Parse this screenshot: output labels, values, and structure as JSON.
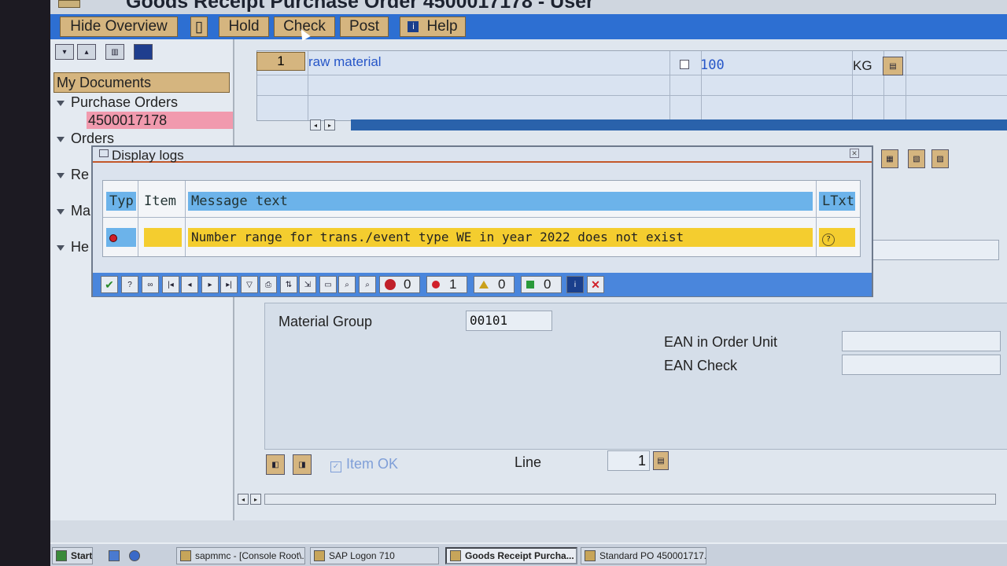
{
  "window": {
    "title": "Goods Receipt Purchase Order 4500017178 - User"
  },
  "toolbar": {
    "hide_overview": "Hide Overview",
    "hold": "Hold",
    "check": "Check",
    "post": "Post",
    "help": "Help"
  },
  "sidebar": {
    "my_documents": "My Documents",
    "purchase_orders": "Purchase Orders",
    "selected_po": "4500017178",
    "orders": "Orders",
    "re": "Re",
    "ma": "Ma",
    "he": "He"
  },
  "item_overview": {
    "line_no": "1",
    "material": "raw material",
    "quantity": "100",
    "unit": "KG"
  },
  "dialog": {
    "title": "Display logs",
    "columns": {
      "typ": "Typ",
      "item": "Item",
      "message": "Message text",
      "ltxt": "LTxt"
    },
    "rows": [
      {
        "message": "Number range for trans./event type WE in year 2022 does not exist"
      }
    ],
    "counts": {
      "stop": "0",
      "error": "1",
      "warning": "0",
      "success": "0"
    }
  },
  "form": {
    "material_group_label": "Material Group",
    "material_group_value": "00101",
    "ean_order_unit_label": "EAN in Order Unit",
    "ean_check_label": "EAN Check",
    "item_ok_label": "Item OK",
    "line_label": "Line",
    "line_value": "1"
  },
  "taskbar": {
    "start": "Start",
    "tasks": [
      "sapmmc - [Console Root\\...",
      "SAP Logon 710",
      "Goods Receipt Purcha...",
      "Standard PO 450001717..."
    ]
  },
  "colors": {
    "toolbar_blue": "#2d6fd2",
    "button_tan": "#d5b57f",
    "highlight_pink": "#f19aae",
    "row_yellow": "#f4cd2f",
    "header_blue": "#6cb3ea",
    "error_red": "#d0202a"
  }
}
